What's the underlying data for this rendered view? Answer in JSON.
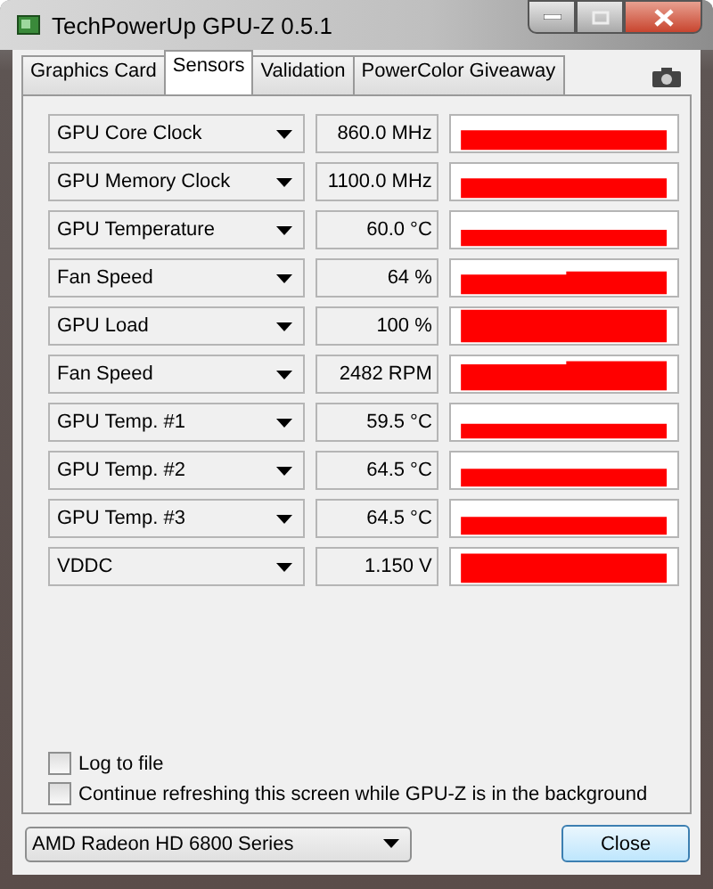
{
  "window": {
    "title": "TechPowerUp GPU-Z 0.5.1"
  },
  "tabs": [
    {
      "label": "Graphics Card",
      "selected": false
    },
    {
      "label": "Sensors",
      "selected": true
    },
    {
      "label": "Validation",
      "selected": false
    },
    {
      "label": "PowerColor Giveaway",
      "selected": false
    }
  ],
  "sensors": [
    {
      "name": "GPU Core Clock",
      "reading": "860.0 MHz"
    },
    {
      "name": "GPU Memory Clock",
      "reading": "1100.0 MHz"
    },
    {
      "name": "GPU Temperature",
      "reading": "60.0 °C"
    },
    {
      "name": "Fan Speed",
      "reading": "64 %"
    },
    {
      "name": "GPU Load",
      "reading": "100 %"
    },
    {
      "name": "Fan Speed",
      "reading": "2482 RPM"
    },
    {
      "name": "GPU Temp. #1",
      "reading": "59.5 °C"
    },
    {
      "name": "GPU Temp. #2",
      "reading": "64.5 °C"
    },
    {
      "name": "GPU Temp. #3",
      "reading": "64.5 °C"
    },
    {
      "name": "VDDC",
      "reading": "1.150 V"
    }
  ],
  "options": [
    {
      "label": "Log to file",
      "checked": false
    },
    {
      "label": "Continue refreshing this screen while GPU-Z is in the background",
      "checked": false
    }
  ],
  "device": {
    "value": "AMD Radeon HD 6800 Series"
  },
  "buttons": [
    {
      "label": "Close"
    }
  ]
}
